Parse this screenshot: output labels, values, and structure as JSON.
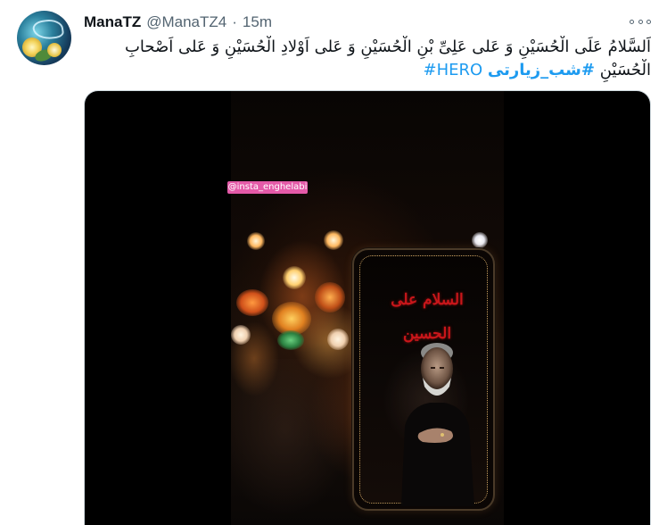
{
  "tweet": {
    "author_name": "ManaTZ",
    "author_handle": "@ManaTZ4",
    "separator": "·",
    "timestamp": "15m",
    "more_icon": "more-horizontal-icon",
    "text_line1": "اَلسَّلامُ عَلَی الْحُسَیْنِ وَ عَلی عَلِیِّ بْنِ الْحُسَیْنِ وَ عَلی اَوْلادِ الْحُسَیْنِ وَ عَلی اَصْحابِ",
    "text_line2_main": "الْحُسَیْنِ",
    "hashtag_fa": "#شب_زیارتی",
    "hashtag_en": "#HERO",
    "accent_color": "#1d9bf0"
  },
  "media": {
    "watermark": "@insta_enghelabi",
    "phone_calligraphy": "السلام علی الحسین",
    "type": "video"
  }
}
